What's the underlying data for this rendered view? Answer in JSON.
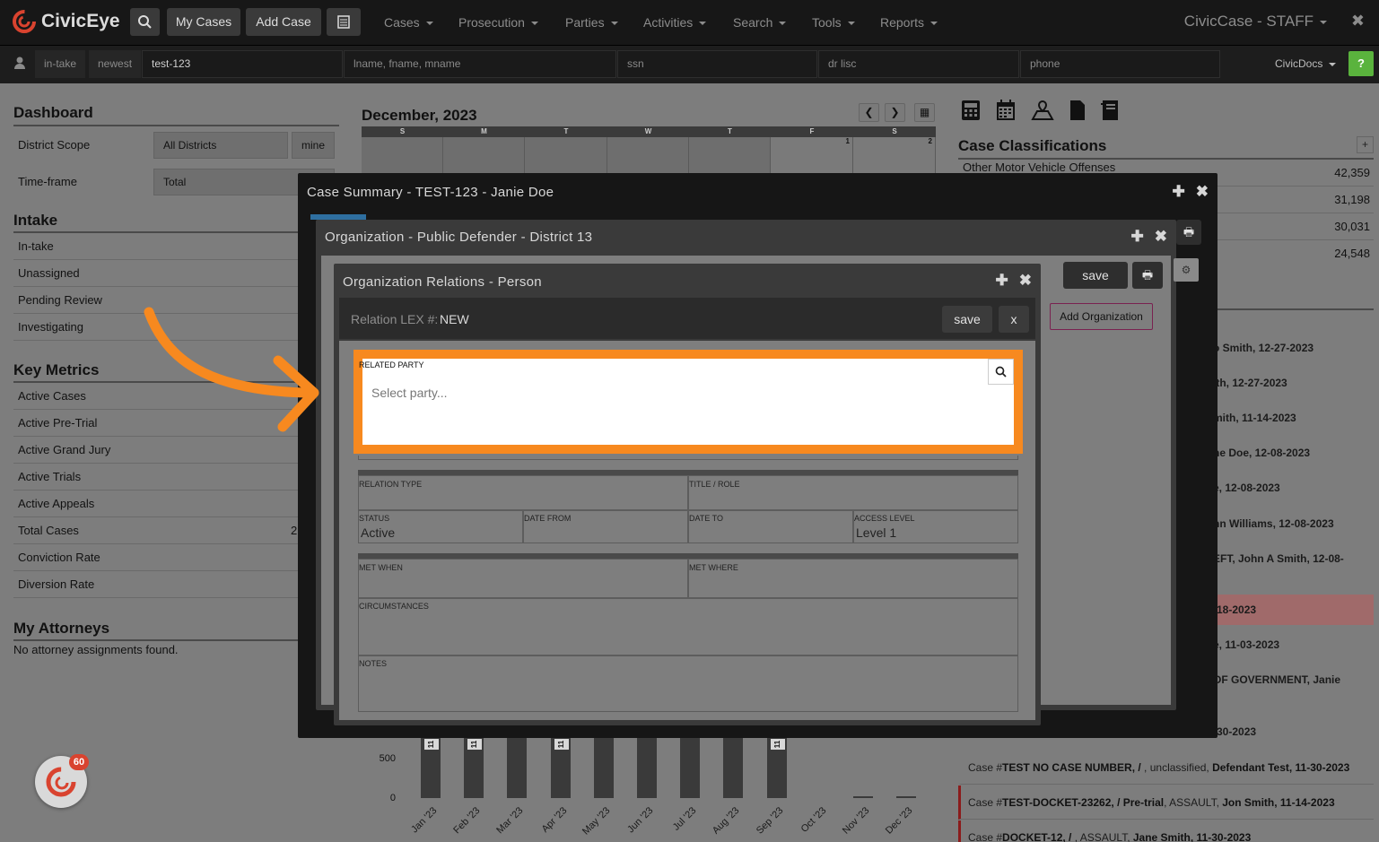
{
  "topnav": {
    "brand_name": "CivicEye",
    "my_cases": "My Cases",
    "add_case": "Add Case",
    "menus": [
      "Cases",
      "Prosecution",
      "Parties",
      "Activities",
      "Search",
      "Tools",
      "Reports"
    ],
    "app_title": "CivicCase - STAFF"
  },
  "searchbar": {
    "in_take": "in-take",
    "newest": "newest",
    "case_value": "test-123",
    "name_placeholder": "lname, fname, mname",
    "ssn_placeholder": "ssn",
    "dl_placeholder": "dr lisc",
    "phone_placeholder": "phone",
    "civicdocs": "CivicDocs",
    "help": "?"
  },
  "dashboard": {
    "title": "Dashboard",
    "district_scope_label": "District Scope",
    "district_scope_value": "All Districts",
    "mine": "mine",
    "timeframe_label": "Time-frame",
    "timeframe_value": "Total",
    "intake_title": "Intake",
    "intake_items": [
      "In-take",
      "Unassigned",
      "Pending Review",
      "Investigating"
    ],
    "metrics_title": "Key Metrics",
    "metrics_items": [
      "Active Cases",
      "Active Pre-Trial",
      "Active Grand Jury",
      "Active Trials",
      "Active Appeals",
      "Total Cases",
      "Conviction Rate",
      "Diversion Rate"
    ],
    "total_cases_partial": "2",
    "attorneys_title": "My Attorneys",
    "attorneys_empty": "No attorney assignments found."
  },
  "calendar": {
    "title": "December, 2023",
    "days": [
      "S",
      "M",
      "T",
      "W",
      "T",
      "F",
      "S"
    ],
    "dates": [
      "",
      "",
      "",
      "",
      "",
      "1",
      "2"
    ]
  },
  "classifications": {
    "title": "Case Classifications",
    "add": "+",
    "first_label": "Other Motor Vehicle Offenses",
    "counts": [
      "42,359",
      "31,198",
      "30,031",
      "24,548"
    ]
  },
  "recent_cases_partial": [
    "o Smith, 12-27-2023",
    "ith, 12-27-2023",
    "mith, 11-14-2023",
    "ne Doe, 12-08-2023",
    "e, 12-08-2023",
    "nn Williams, 12-08-2023",
    "EFT, John A Smith, 12-08-",
    "-18-2023",
    "e, 11-03-2023",
    "OF GOVERNMENT, Janie",
    "-30-2023"
  ],
  "recent_cases": [
    {
      "prefix": "Case #",
      "number": "TEST NO CASE NUMBER, / ",
      "mid": ", unclassified, ",
      "party": "Defendant Test, 11-30-2023"
    },
    {
      "prefix": "Case #",
      "number": "TEST-DOCKET-23262, / Pre-trial",
      "mid": ", ASSAULT, ",
      "party": "Jon Smith, 11-14-2023"
    },
    {
      "prefix": "Case #",
      "number": "DOCKET-12, / ",
      "mid": ", ASSAULT, ",
      "party": "Jane Smith, 11-30-2023"
    }
  ],
  "chart_data": {
    "type": "bar",
    "categories": [
      "Jan '23",
      "Feb '23",
      "Mar '23",
      "Apr '23",
      "May '23",
      "Jun '23",
      "Jul '23",
      "Aug '23",
      "Sep '23",
      "Oct '23",
      "Nov '23",
      "Dec '23"
    ],
    "y_ticks": [
      "500",
      "0"
    ],
    "bar_labels": [
      "11",
      "11",
      "",
      "11",
      "",
      "",
      "",
      "",
      "11",
      "",
      "",
      ""
    ]
  },
  "modal_case": {
    "title": "Case Summary - TEST-123 - Janie Doe"
  },
  "modal_org": {
    "title": "Organization - Public Defender - District 13",
    "save": "save",
    "add_org": "Add Organization"
  },
  "modal_rel": {
    "title": "Organization Relations - Person",
    "lex_label": "Relation LEX #:",
    "lex_value": "NEW",
    "save": "save",
    "close": "x",
    "related_party_label": "RELATED PARTY",
    "related_party_placeholder": "Select party...",
    "relation_type_label": "RELATION TYPE",
    "title_role_label": "TITLE / ROLE",
    "status_label": "STATUS",
    "status_value": "Active",
    "date_from_label": "DATE FROM",
    "date_to_label": "DATE TO",
    "access_level_label": "ACCESS LEVEL",
    "access_level_value": "Level 1",
    "met_when_label": "MET WHEN",
    "met_where_label": "MET WHERE",
    "circumstances_label": "CIRCUMSTANCES",
    "notes_label": "NOTES"
  },
  "badge": {
    "count": "60"
  },
  "colors": {
    "accent": "#f7891f",
    "brand": "#d9432f",
    "help": "#5ab33d"
  }
}
